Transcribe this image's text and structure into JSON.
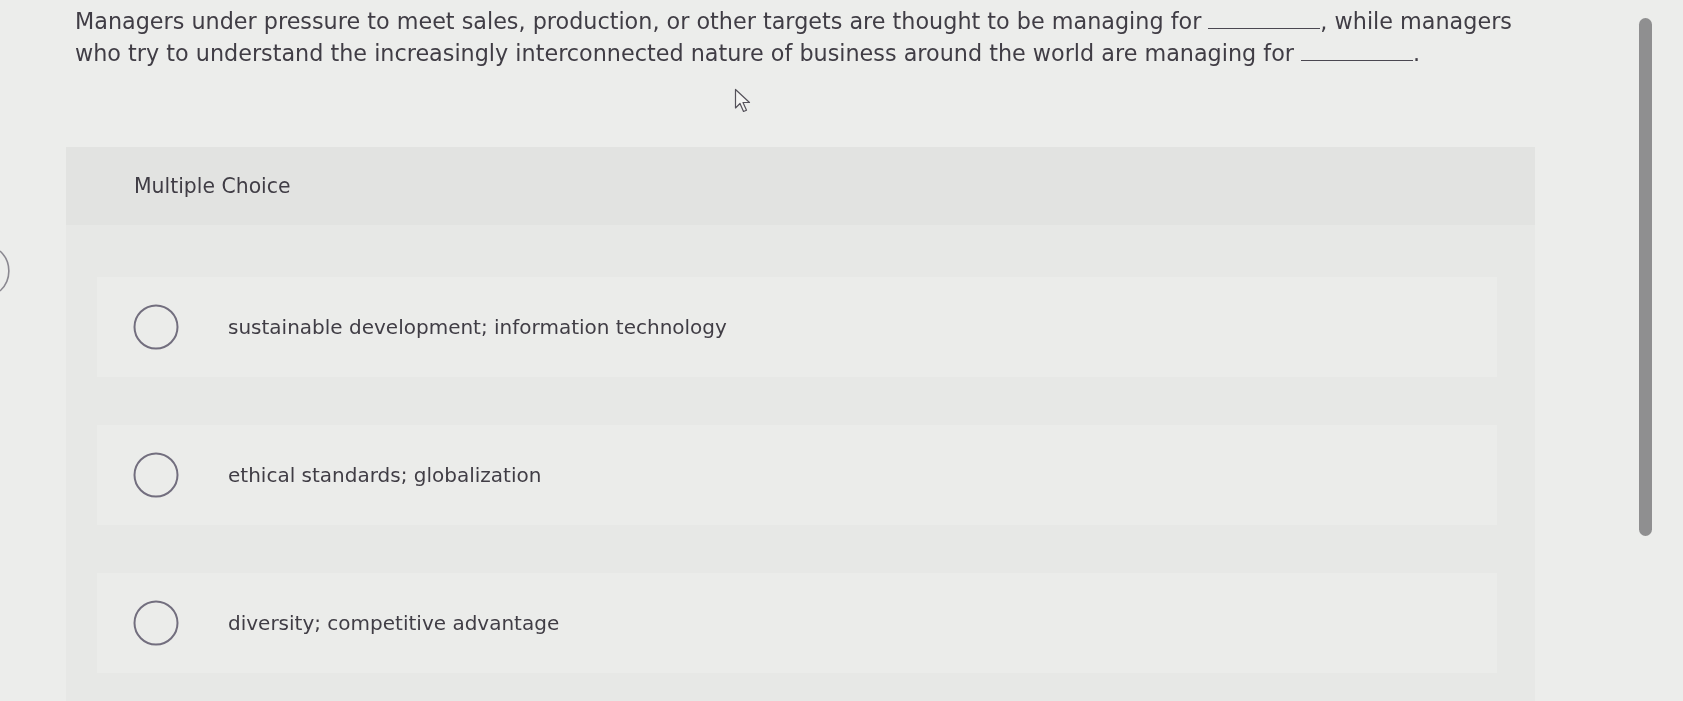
{
  "question": {
    "lines": [
      [
        {
          "kind": "text",
          "text": "Managers under pressure to meet sales, production, or other targets are thought to be managing for"
        },
        {
          "kind": "blank"
        },
        {
          "kind": "text",
          "text": ", while managers"
        }
      ],
      [
        {
          "kind": "text",
          "text": "who try to understand the increasingly interconnected nature of business around the world are managing for"
        },
        {
          "kind": "blank"
        },
        {
          "kind": "text",
          "text": "."
        }
      ]
    ]
  },
  "answer_panel": {
    "title": "Multiple Choice",
    "options": [
      {
        "label": "sustainable development; information technology",
        "selected": false
      },
      {
        "label": "ethical standards; globalization",
        "selected": false
      },
      {
        "label": "diversity; competitive advantage",
        "selected": false
      }
    ]
  }
}
